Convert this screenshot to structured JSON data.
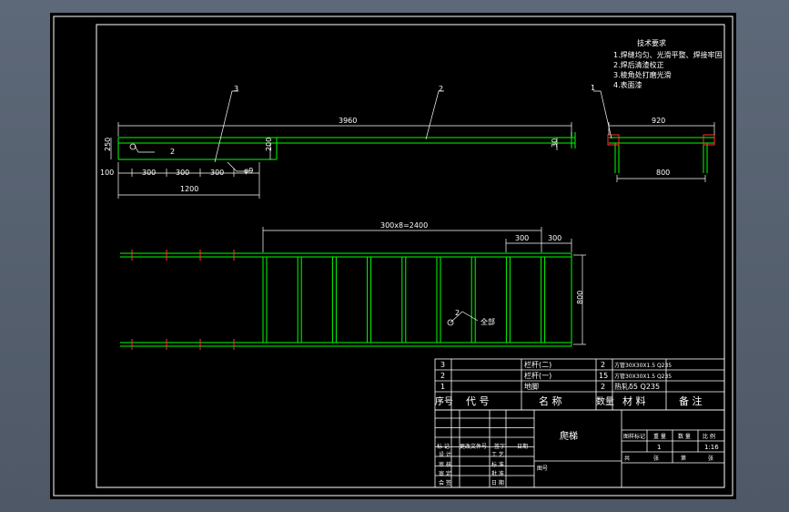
{
  "colors": {
    "background": "#000000",
    "frame": "#ffffff",
    "geometry": "#00ff00",
    "centerline": "#ff3030",
    "table_text": "#ffffff",
    "outer": "#56606e"
  },
  "tech_requirements": {
    "title": "技术要求",
    "items": [
      "1.焊缝均匀、光滑平整、焊接牢固",
      "2.焊后清渣校正",
      "3.棱角处打磨光滑",
      "4.表面漆"
    ]
  },
  "balloons": [
    "1",
    "2",
    "3"
  ],
  "dims": {
    "overall_length": "3960",
    "height_250": "250",
    "height_200": "200",
    "d100": "100",
    "d300a": "300",
    "d300b": "300",
    "d300c": "300",
    "d1200": "1200",
    "d30": "30",
    "side_920": "920",
    "side_800": "800",
    "spacing_total": "300x8=2400",
    "spacing_a": "300",
    "spacing_b": "300",
    "width_800": "800"
  },
  "weld_notes": {
    "front_weld": "2",
    "front_phi": "φ9",
    "plan_weld": "2",
    "plan_note": "全部"
  },
  "bom": {
    "rows": [
      {
        "no": "3",
        "code": "",
        "name": "栏杆(二)",
        "qty": "2",
        "material": "方管30X30X1.5 Q235",
        "note": ""
      },
      {
        "no": "2",
        "code": "",
        "name": "栏杆(一)",
        "qty": "15",
        "material": "方管30X30X1.5 Q235",
        "note": ""
      },
      {
        "no": "1",
        "code": "",
        "name": "地脚",
        "qty": "2",
        "material": "热轧δ5 Q235",
        "note": ""
      }
    ],
    "header": {
      "no": "序号",
      "code": "代 号",
      "name": "名 称",
      "qty": "数量",
      "material": "材 料",
      "note": "备 注"
    }
  },
  "title_block": {
    "drawing_name": "爬梯",
    "stage_label": "图样标记",
    "weight_label": "重 量",
    "qty_label": "数 量",
    "scale_label": "比 例",
    "qty_value": "1",
    "scale_value": "1:16",
    "sheet_total_label": "共",
    "sheet_label": "张",
    "sheet_no_label": "第",
    "sheet_no_suffix": "张",
    "rev_labels": [
      "标 记",
      "更改文件号",
      "签字",
      "日期"
    ],
    "roles": [
      "设 计",
      "审 核",
      "审 定",
      "会 签"
    ],
    "roles2": [
      "工 艺",
      "标 准",
      "批 准",
      "日 期"
    ],
    "company": "图号"
  }
}
